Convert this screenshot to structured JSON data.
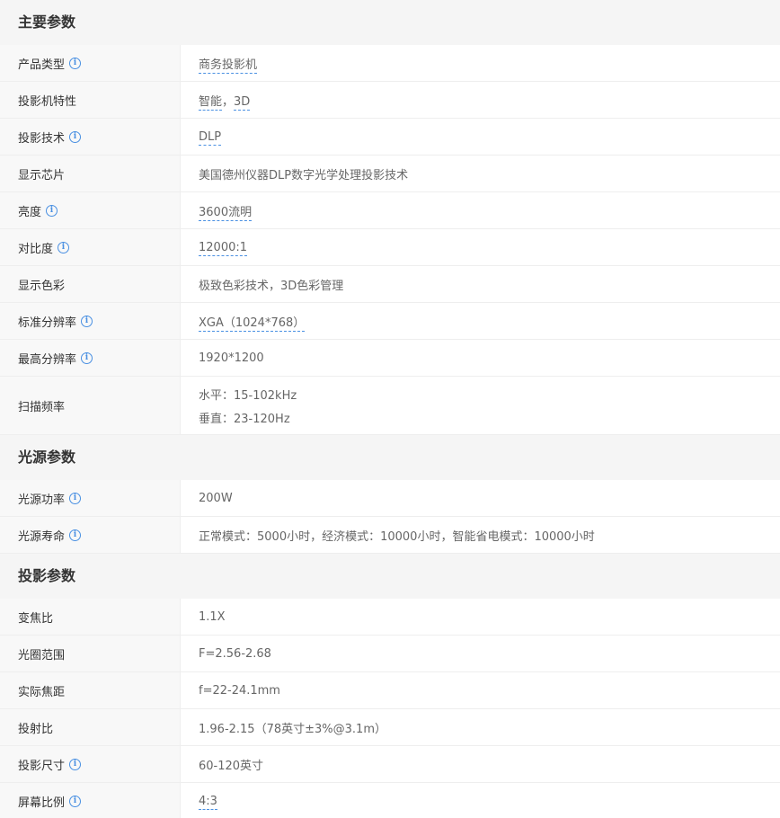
{
  "sections": [
    {
      "title": "主要参数",
      "rows": [
        {
          "name": "产品类型",
          "info": true,
          "value": "商务投影机",
          "link": true
        },
        {
          "name": "投影机特性",
          "info": false,
          "parts": [
            "智能",
            "，",
            "3D"
          ]
        },
        {
          "name": "投影技术",
          "info": true,
          "value": "DLP",
          "link": true
        },
        {
          "name": "显示芯片",
          "info": false,
          "value": "美国德州仪器DLP数字光学处理投影技术",
          "link": false
        },
        {
          "name": "亮度",
          "info": true,
          "value": "3600流明",
          "link": true
        },
        {
          "name": "对比度",
          "info": true,
          "value": "12000:1",
          "link": true
        },
        {
          "name": "显示色彩",
          "info": false,
          "value": "极致色彩技术，3D色彩管理",
          "link": false
        },
        {
          "name": "标准分辨率",
          "info": true,
          "value": "XGA（1024*768）",
          "link": true
        },
        {
          "name": "最高分辨率",
          "info": true,
          "value": "1920*1200",
          "link": false
        },
        {
          "name": "扫描频率",
          "info": false,
          "value": "水平：15-102kHz",
          "value2": "垂直：23-120Hz",
          "link": false
        }
      ]
    },
    {
      "title": "光源参数",
      "rows": [
        {
          "name": "光源功率",
          "info": true,
          "value": "200W",
          "link": false
        },
        {
          "name": "光源寿命",
          "info": true,
          "value": "正常模式：5000小时，经济模式：10000小时，智能省电模式：10000小时",
          "link": false
        }
      ]
    },
    {
      "title": "投影参数",
      "rows": [
        {
          "name": "变焦比",
          "info": false,
          "value": "1.1X",
          "link": false
        },
        {
          "name": "光圈范围",
          "info": false,
          "value": "F=2.56-2.68",
          "link": false
        },
        {
          "name": "实际焦距",
          "info": false,
          "value": "f=22-24.1mm",
          "link": false
        },
        {
          "name": "投射比",
          "info": false,
          "value": "1.96-2.15（78英寸±3%@3.1m）",
          "link": false
        },
        {
          "name": "投影尺寸",
          "info": true,
          "value": "60-120英寸",
          "link": false
        },
        {
          "name": "屏幕比例",
          "info": true,
          "value": "4:3",
          "link": true
        }
      ]
    }
  ],
  "info_glyph": "i",
  "accent_color": "#4a90e2"
}
